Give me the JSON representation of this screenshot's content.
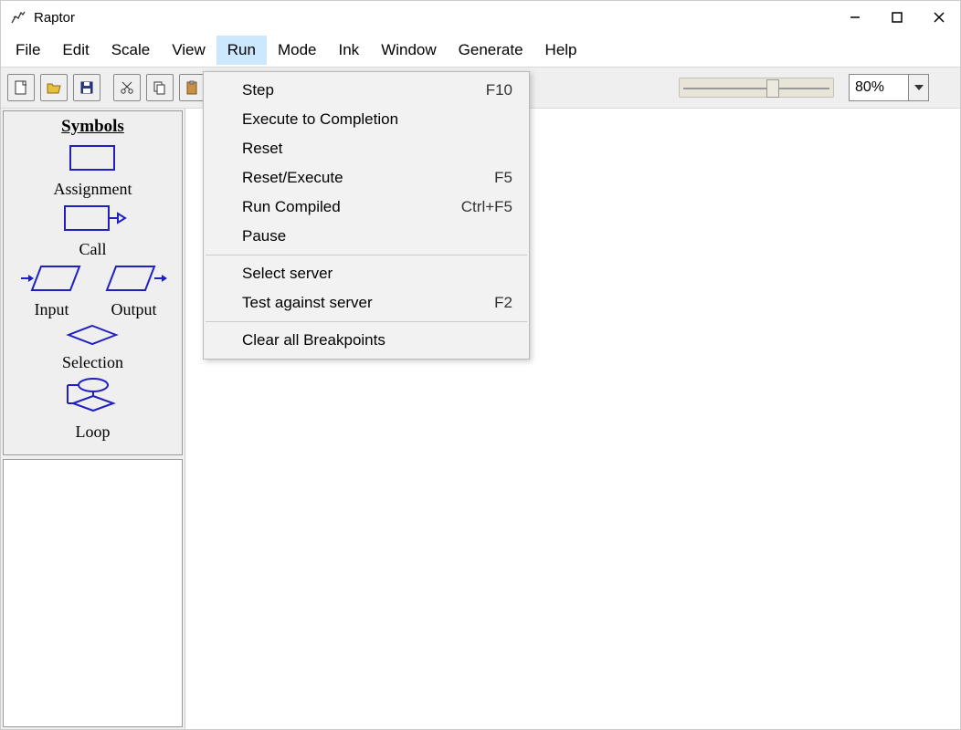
{
  "app": {
    "title": "Raptor"
  },
  "menubar": {
    "items": [
      "File",
      "Edit",
      "Scale",
      "View",
      "Run",
      "Mode",
      "Ink",
      "Window",
      "Generate",
      "Help"
    ],
    "active_index": 4
  },
  "dropdown": {
    "groups": [
      [
        {
          "label": "Step",
          "shortcut": "F10"
        },
        {
          "label": "Execute to Completion",
          "shortcut": ""
        },
        {
          "label": "Reset",
          "shortcut": ""
        },
        {
          "label": "Reset/Execute",
          "shortcut": "F5"
        },
        {
          "label": "Run Compiled",
          "shortcut": "Ctrl+F5"
        },
        {
          "label": "Pause",
          "shortcut": ""
        }
      ],
      [
        {
          "label": "Select server",
          "shortcut": ""
        },
        {
          "label": "Test against server",
          "shortcut": "F2"
        }
      ],
      [
        {
          "label": "Clear all Breakpoints",
          "shortcut": ""
        }
      ]
    ]
  },
  "toolbar": {
    "zoom_value": "80%"
  },
  "symbols": {
    "title": "Symbols",
    "items": {
      "assignment": "Assignment",
      "call": "Call",
      "input": "Input",
      "output": "Output",
      "selection": "Selection",
      "loop": "Loop"
    }
  }
}
